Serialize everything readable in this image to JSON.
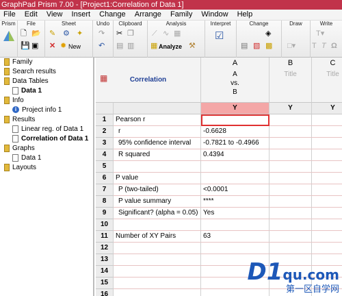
{
  "window": {
    "title": "GraphPad Prism 7.00 - [Project1:Correlation of Data 1]"
  },
  "menu": [
    "File",
    "Edit",
    "View",
    "Insert",
    "Change",
    "Arrange",
    "Family",
    "Window",
    "Help"
  ],
  "toolbar_groups": {
    "prism": "Prism",
    "file": "File",
    "sheet": "Sheet",
    "undo": "Undo",
    "clipboard": "Clipboard",
    "analysis": "Analysis",
    "interpret": "Interpret",
    "change": "Change",
    "draw": "Draw",
    "write": "Write",
    "analyze_label": "Analyze",
    "new_label": "New"
  },
  "sidebar": {
    "items": [
      {
        "label": "Family"
      },
      {
        "label": "Search results"
      },
      {
        "label": "Data Tables"
      },
      {
        "label": "Data 1"
      },
      {
        "label": "Info"
      },
      {
        "label": "Project info 1"
      },
      {
        "label": "Results"
      },
      {
        "label": "Linear reg. of Data 1"
      },
      {
        "label": "Correlation of Data 1"
      },
      {
        "label": "Graphs"
      },
      {
        "label": "Data 1"
      },
      {
        "label": "Layouts"
      }
    ]
  },
  "table": {
    "corner_label": "Correlation",
    "columns": [
      {
        "letter": "A",
        "title_line1": "A",
        "title_line2": "vs.",
        "title_line3": "B",
        "y": "Y"
      },
      {
        "letter": "B",
        "title": "Title",
        "y": "Y"
      },
      {
        "letter": "C",
        "title": "Title",
        "y": "Y"
      }
    ],
    "rows": [
      {
        "num": "1",
        "label": "Pearson r",
        "value": ""
      },
      {
        "num": "2",
        "label": "r",
        "value": "-0.6628"
      },
      {
        "num": "3",
        "label": "95% confidence interval",
        "value": "-0.7821 to -0.4966"
      },
      {
        "num": "4",
        "label": "R squared",
        "value": "0.4394"
      },
      {
        "num": "5",
        "label": "",
        "value": ""
      },
      {
        "num": "6",
        "label": "P value",
        "value": ""
      },
      {
        "num": "7",
        "label": "P (two-tailed)",
        "value": "<0.0001"
      },
      {
        "num": "8",
        "label": "P value summary",
        "value": "****"
      },
      {
        "num": "9",
        "label": "Significant? (alpha = 0.05)",
        "value": "Yes"
      },
      {
        "num": "10",
        "label": "",
        "value": ""
      },
      {
        "num": "11",
        "label": "Number of XY Pairs",
        "value": "63"
      },
      {
        "num": "12",
        "label": "",
        "value": ""
      },
      {
        "num": "13",
        "label": "",
        "value": ""
      },
      {
        "num": "14",
        "label": "",
        "value": ""
      },
      {
        "num": "15",
        "label": "",
        "value": ""
      },
      {
        "num": "16",
        "label": "",
        "value": ""
      }
    ]
  },
  "watermark": {
    "brand": "D1",
    "suffix": "qu.com",
    "sub": "第一区自学网"
  }
}
